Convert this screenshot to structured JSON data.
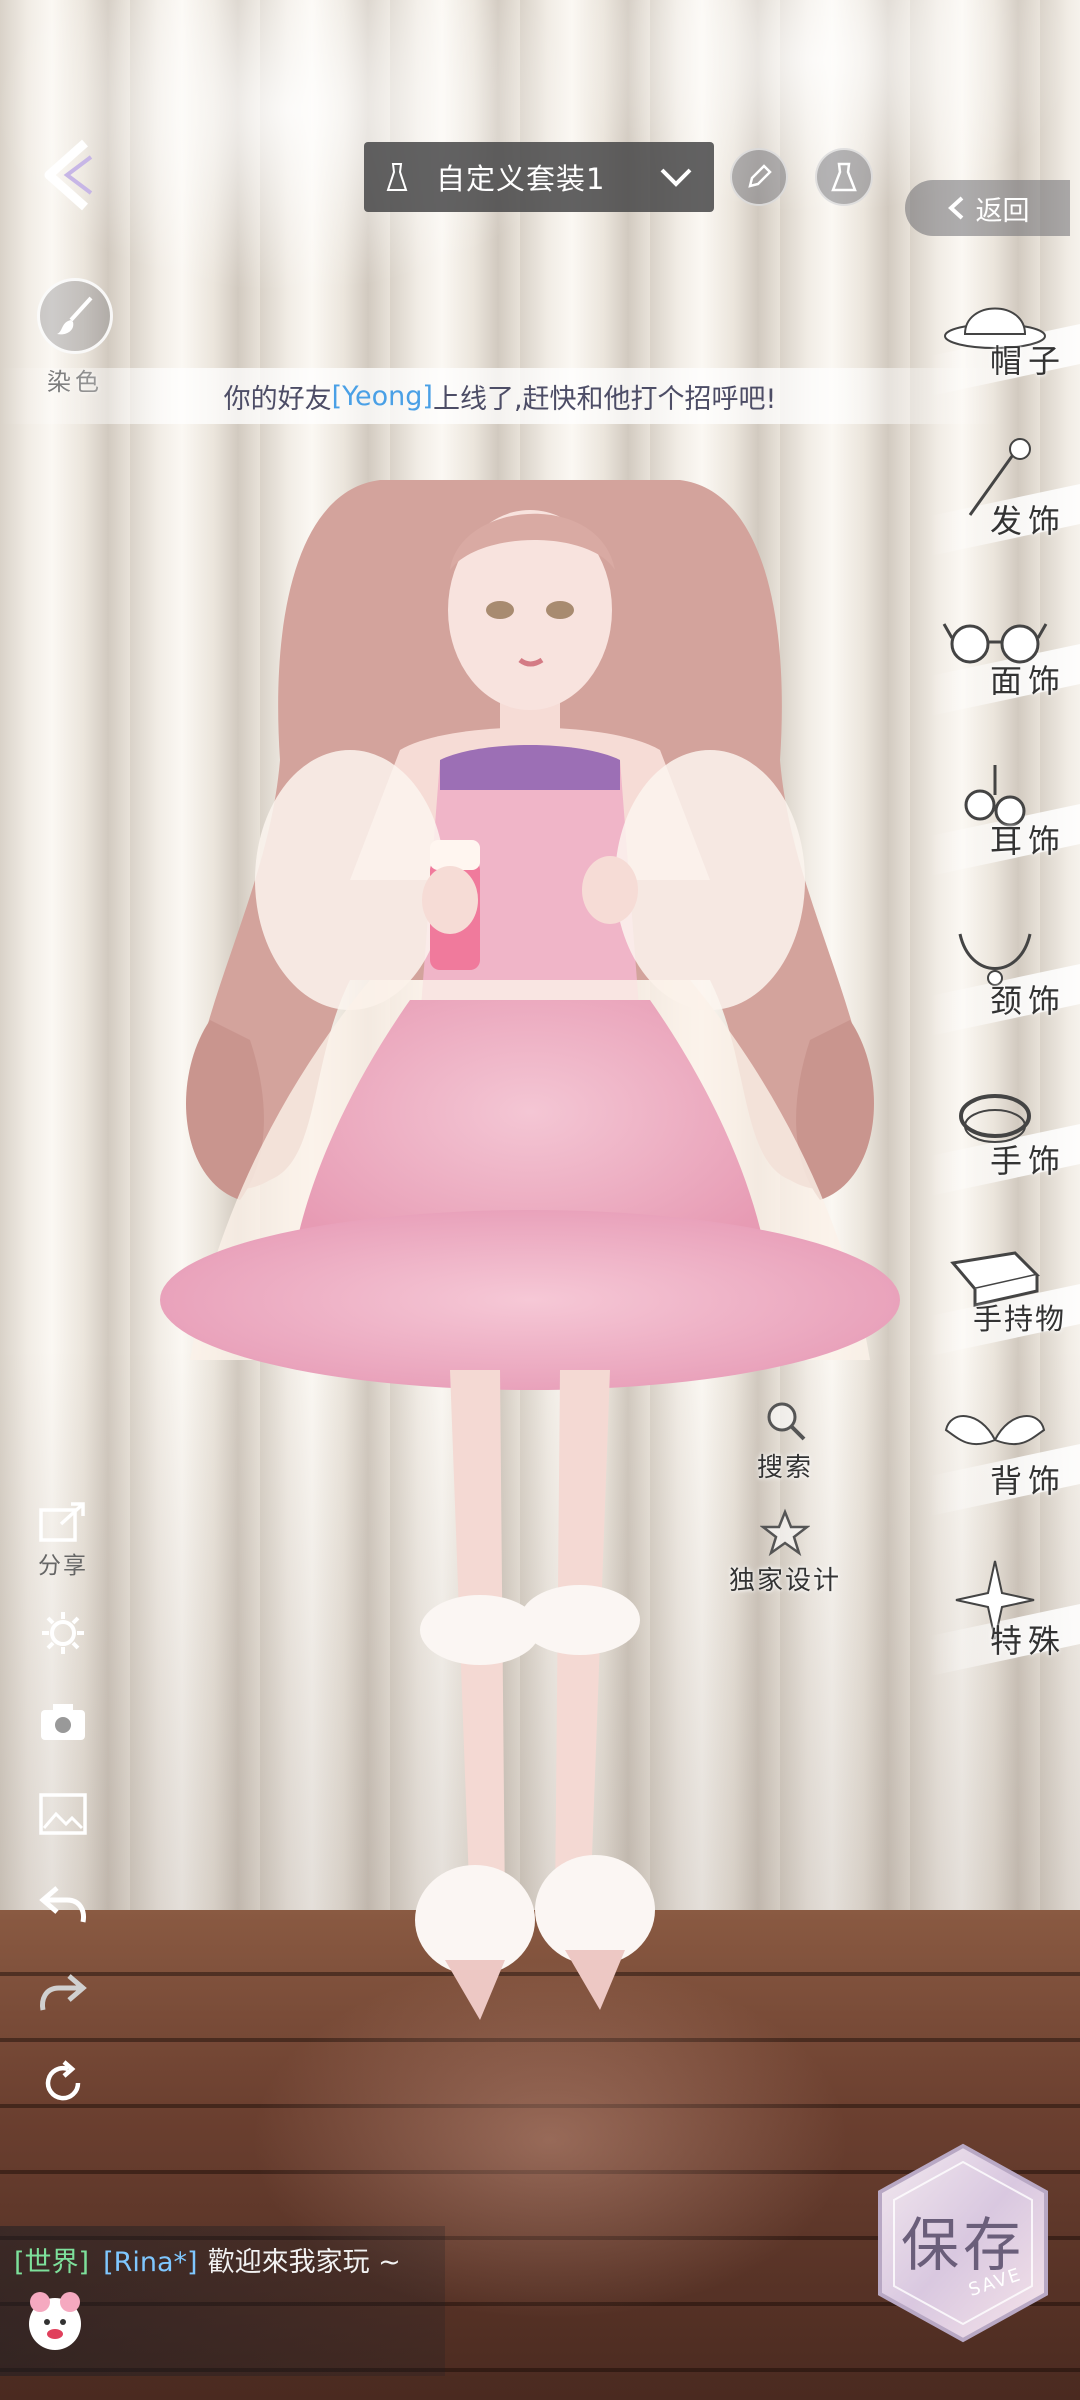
{
  "top_bar": {
    "outfit_name": "自定义套装1",
    "return_label": "返回"
  },
  "dye": {
    "label": "染色"
  },
  "notification": {
    "prefix": "你的好友",
    "friend": "[Yeong]",
    "suffix": "上线了,赶快和他打个招呼吧!"
  },
  "categories": [
    {
      "label": "帽子",
      "icon": "hat-icon"
    },
    {
      "label": "发饰",
      "icon": "hairpin-icon"
    },
    {
      "label": "面饰",
      "icon": "glasses-icon"
    },
    {
      "label": "耳饰",
      "icon": "earring-icon"
    },
    {
      "label": "颈饰",
      "icon": "necklace-icon"
    },
    {
      "label": "手饰",
      "icon": "bracelet-icon"
    },
    {
      "label": "手持物",
      "icon": "handheld-icon"
    },
    {
      "label": "背饰",
      "icon": "wings-icon"
    },
    {
      "label": "特殊",
      "icon": "special-icon"
    }
  ],
  "actions": {
    "search_label": "搜索",
    "design_label": "独家设计"
  },
  "tools": {
    "share_label": "分享"
  },
  "chat": {
    "channel": "[世界]",
    "sender": "[Rina*]",
    "message": "歡迎來我家玩 ~"
  },
  "save": {
    "label": "保存",
    "sub_label": "SAVE"
  }
}
